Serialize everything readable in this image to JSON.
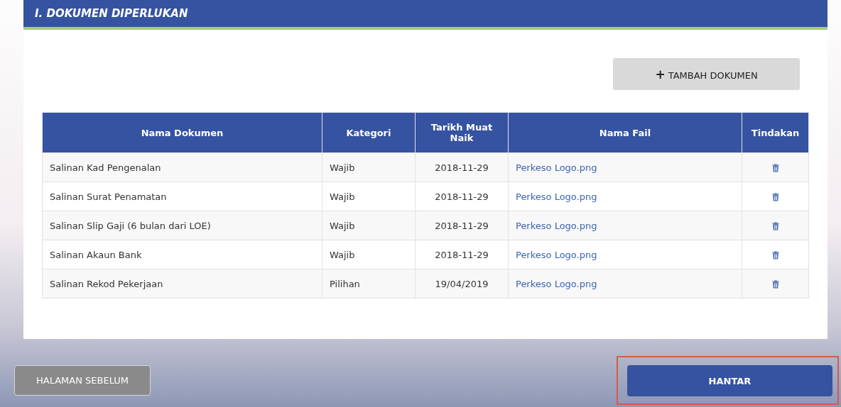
{
  "section": {
    "title": "I. DOKUMEN DIPERLUKAN"
  },
  "add_button": {
    "icon": "+",
    "label": "TAMBAH DOKUMEN"
  },
  "table": {
    "columns": [
      "Nama Dokumen",
      "Kategori",
      "Tarikh Muat Naik",
      "Nama Fail",
      "Tindakan"
    ],
    "rows": [
      {
        "name": "Salinan Kad Pengenalan",
        "category": "Wajib",
        "date": "2018-11-29",
        "file": "Perkeso Logo.png"
      },
      {
        "name": "Salinan Surat Penamatan",
        "category": "Wajib",
        "date": "2018-11-29",
        "file": "Perkeso Logo.png"
      },
      {
        "name": "Salinan Slip Gaji (6 bulan dari LOE)",
        "category": "Wajib",
        "date": "2018-11-29",
        "file": "Perkeso Logo.png"
      },
      {
        "name": "Salinan Akaun Bank",
        "category": "Wajib",
        "date": "2018-11-29",
        "file": "Perkeso Logo.png"
      },
      {
        "name": "Salinan Rekod Pekerjaan",
        "category": "Pilihan",
        "date": "19/04/2019",
        "file": "Perkeso Logo.png"
      }
    ]
  },
  "footer": {
    "back_button": {
      "label": "HALAMAN SEBELUM"
    },
    "submit_button": {
      "label": "HANTAR",
      "highlighted": true
    }
  }
}
